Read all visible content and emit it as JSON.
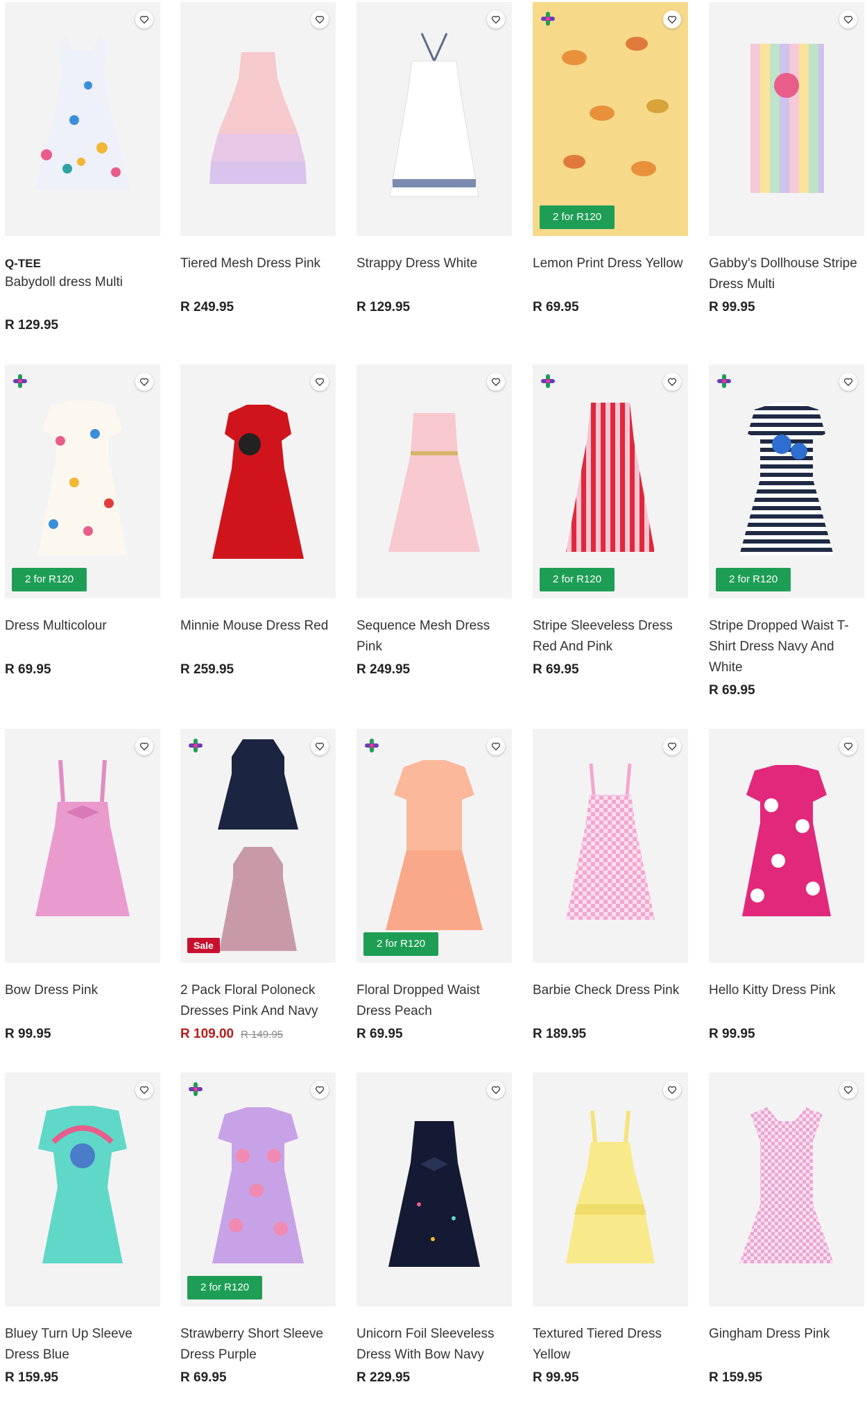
{
  "promo_label": "2 for R120",
  "sale_label": "Sale",
  "accent_green": "#1e9e55",
  "products": [
    {
      "brand": "Q-TEE",
      "title": "Babydoll dress Multi",
      "price": "R 129.95"
    },
    {
      "title": "Tiered Mesh Dress Pink",
      "price": "R 249.95"
    },
    {
      "title": "Strappy Dress White",
      "price": "R 129.95"
    },
    {
      "title": "Lemon Print Dress Yellow",
      "price": "R 69.95"
    },
    {
      "title": "Gabby's Dollhouse Stripe Dress Multi",
      "price": "R 99.95"
    },
    {
      "title": "Dress Multicolour",
      "price": "R 69.95"
    },
    {
      "title": "Minnie Mouse Dress Red",
      "price": "R 259.95"
    },
    {
      "title": "Sequence Mesh Dress Pink",
      "price": "R 249.95"
    },
    {
      "title": "Stripe Sleeveless Dress Red And Pink",
      "price": "R 69.95"
    },
    {
      "title": "Stripe Dropped Waist T-Shirt Dress Navy And White",
      "price": "R 69.95"
    },
    {
      "title": "Bow Dress Pink",
      "price": "R 99.95"
    },
    {
      "title": "2 Pack Floral Poloneck Dresses Pink And Navy",
      "price": "R 109.00",
      "was_price": "R 149.95"
    },
    {
      "title": "Floral Dropped Waist Dress Peach",
      "price": "R 69.95"
    },
    {
      "title": "Barbie Check Dress Pink",
      "price": "R 189.95"
    },
    {
      "title": "Hello Kitty Dress Pink",
      "price": "R 99.95"
    },
    {
      "title": "Bluey Turn Up Sleeve Dress Blue",
      "price": "R 159.95"
    },
    {
      "title": "Strawberry Short Sleeve Dress Purple",
      "price": "R 69.95"
    },
    {
      "title": "Unicorn Foil Sleeveless Dress With Bow Navy",
      "price": "R 229.95"
    },
    {
      "title": "Textured Tiered Dress Yellow",
      "price": "R 99.95"
    },
    {
      "title": "Gingham Dress Pink",
      "price": "R 159.95"
    }
  ]
}
